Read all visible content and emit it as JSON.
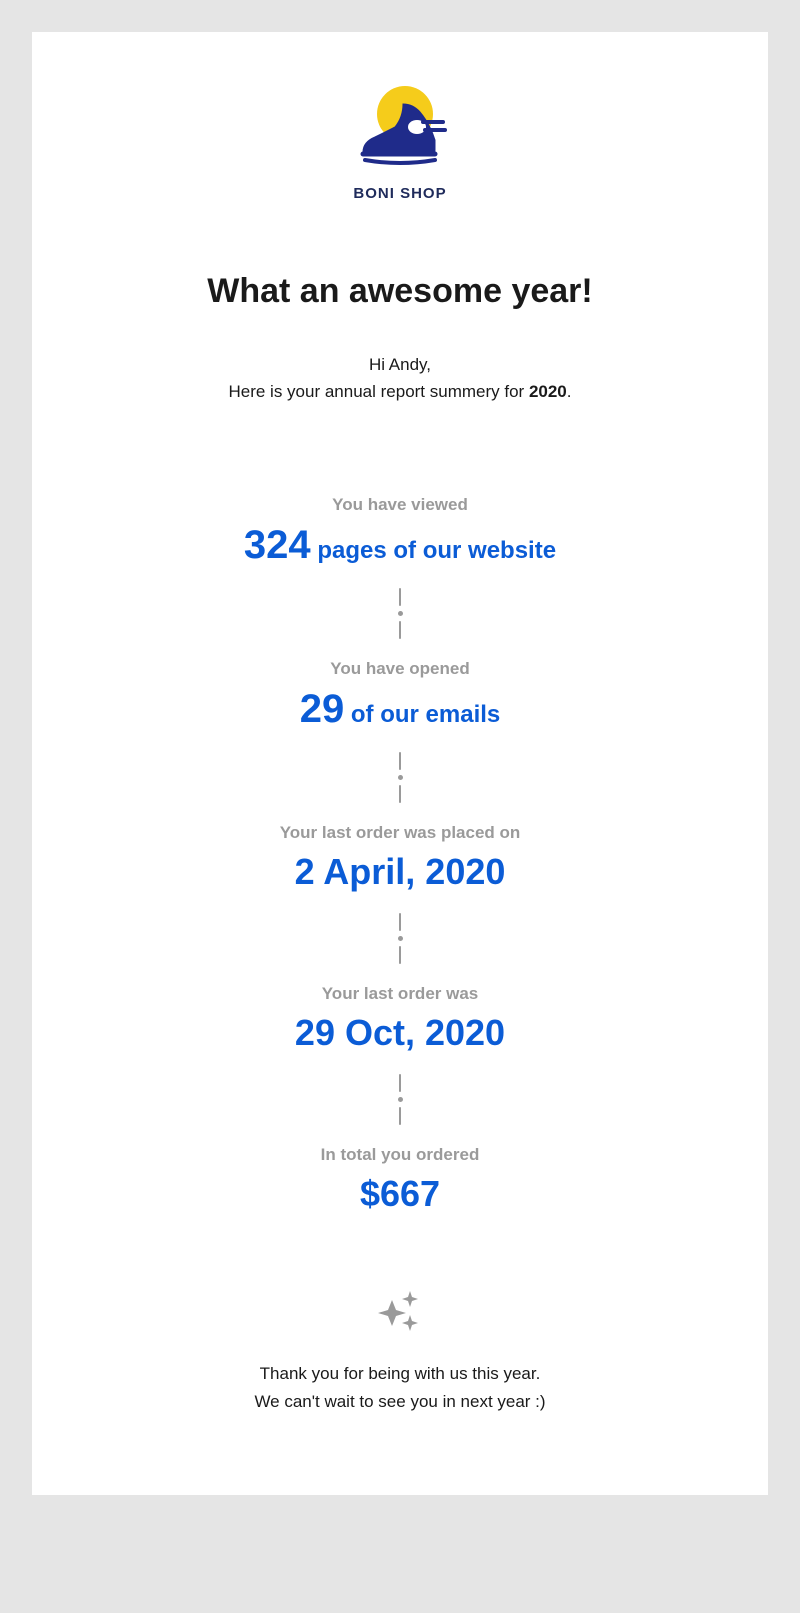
{
  "brand_name": "BONI SHOP",
  "headline": "What an awesome year!",
  "greeting": "Hi Andy,",
  "intro_prefix": "Here is your annual report summery for ",
  "intro_year": "2020",
  "intro_suffix": ".",
  "stats": {
    "pages": {
      "label": "You have viewed",
      "number": "324",
      "suffix": " pages of our website"
    },
    "emails": {
      "label": "You have opened",
      "number": "29",
      "suffix": " of our emails"
    },
    "first_order": {
      "label": "Your last order was placed on",
      "value": "2 April, 2020"
    },
    "last_order": {
      "label": "Your last order was",
      "value": "29 Oct, 2020"
    },
    "total": {
      "label": "In total you ordered",
      "value": "$667"
    }
  },
  "closing_line1": "Thank you for being with us this year.",
  "closing_line2": "We can't wait to see you in next year :)"
}
